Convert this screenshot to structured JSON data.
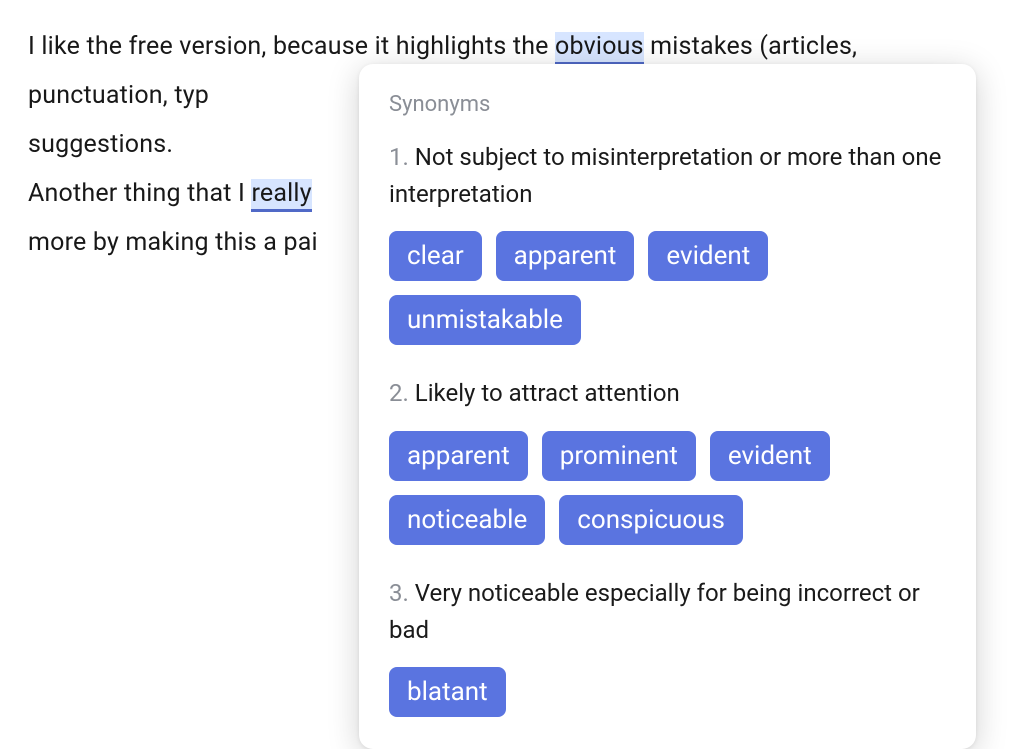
{
  "document": {
    "text_parts": [
      "I like the free version, because it highlights the ",
      "obvious",
      " mistakes (articles, punctuation, typ",
      " suggestions.",
      "Another thing that I ",
      "really",
      " more by making this a pai"
    ]
  },
  "popover": {
    "title": "Synonyms",
    "senses": [
      {
        "num": "1.",
        "definition": "Not subject to misinterpretation or more than one interpretation",
        "chips": [
          "clear",
          "apparent",
          "evident",
          "unmistakable"
        ]
      },
      {
        "num": "2.",
        "definition": "Likely to attract attention",
        "chips": [
          "apparent",
          "prominent",
          "evident",
          "noticeable",
          "conspicuous"
        ]
      },
      {
        "num": "3.",
        "definition": "Very noticeable especially for being incorrect or bad",
        "chips": [
          "blatant"
        ]
      }
    ]
  }
}
